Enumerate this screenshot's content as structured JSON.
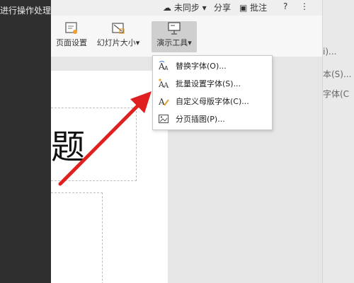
{
  "left_strip": {
    "partial_title": "进行操作处理"
  },
  "topbar": {
    "sync": "未同步",
    "share": "分享",
    "comment": "批注",
    "help": "?",
    "more": "⋮"
  },
  "ribbon": {
    "page_setup": "页面设置",
    "slide_size": "幻灯片大小",
    "presentation_tools": "演示工具"
  },
  "menu": {
    "items": [
      {
        "label": "替换字体(O)...",
        "icon": "replace-font-icon"
      },
      {
        "label": "批量设置字体(S)...",
        "icon": "batch-font-icon"
      },
      {
        "label": "自定义母版字体(C)...",
        "icon": "custom-master-font-icon"
      },
      {
        "label": "分页插图(P)...",
        "icon": "paged-image-icon"
      }
    ]
  },
  "slide": {
    "visible_char": "题"
  },
  "right_strip": {
    "line1": "i)...",
    "line2": "本(S)...",
    "line3": "字体(C"
  },
  "colors": {
    "arrow": "#e02020",
    "active_button": "#cfcfcf"
  }
}
